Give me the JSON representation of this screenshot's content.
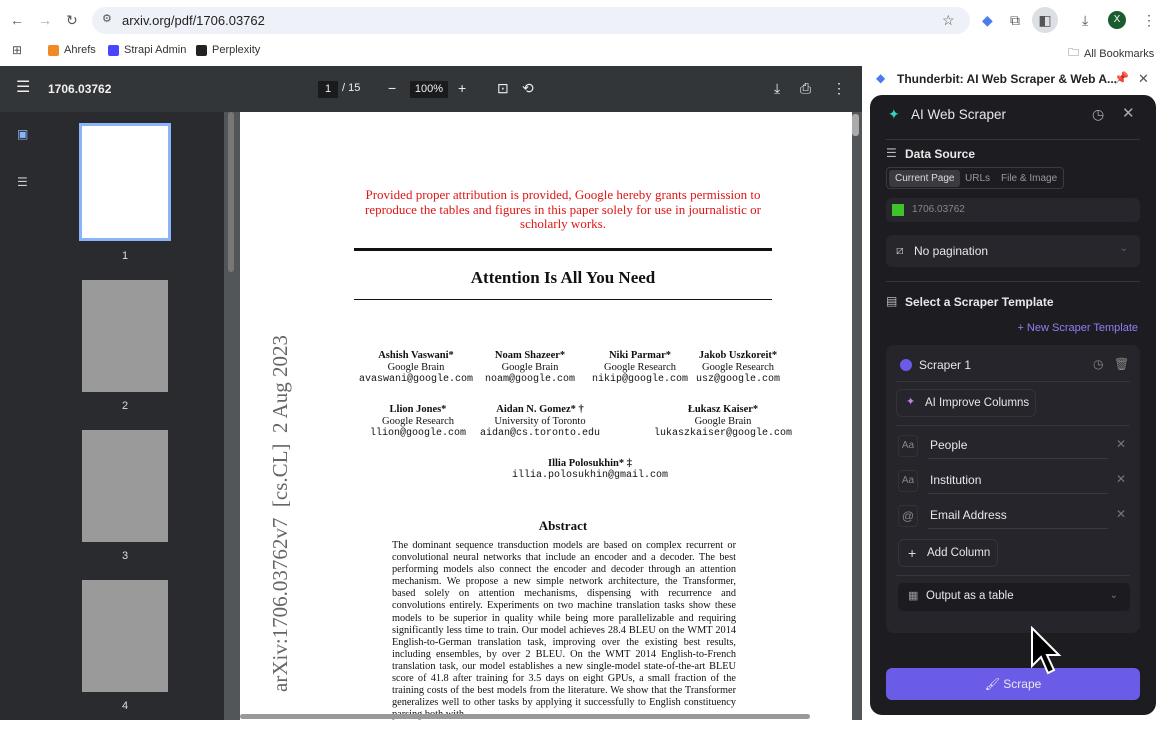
{
  "browser": {
    "url": "arxiv.org/pdf/1706.03762",
    "bookmarks": [
      "Ahrefs",
      "Strapi Admin",
      "Perplexity"
    ],
    "all_bookmarks": "All Bookmarks",
    "profile_initial": "X"
  },
  "pdf_toolbar": {
    "title": "1706.03762",
    "page": "1",
    "total": "/ 15",
    "zoom": "100%"
  },
  "thumbnails": [
    "1",
    "2",
    "3",
    "4"
  ],
  "paper": {
    "notice": "Provided proper attribution is provided, Google hereby grants permission to reproduce the tables and figures in this paper solely for use in journalistic or scholarly works.",
    "title": "Attention Is All You Need",
    "arxiv_id": "arXiv:1706.03762v7  [cs.CL]  2 Aug 2023",
    "authors": [
      {
        "name": "Ashish Vaswani*",
        "inst": "Google Brain",
        "email": "avaswani@google.com"
      },
      {
        "name": "Noam Shazeer*",
        "inst": "Google Brain",
        "email": "noam@google.com"
      },
      {
        "name": "Niki Parmar*",
        "inst": "Google Research",
        "email": "nikip@google.com"
      },
      {
        "name": "Jakob Uszkoreit*",
        "inst": "Google Research",
        "email": "usz@google.com"
      },
      {
        "name": "Llion Jones*",
        "inst": "Google Research",
        "email": "llion@google.com"
      },
      {
        "name": "Aidan N. Gomez* †",
        "inst": "University of Toronto",
        "email": "aidan@cs.toronto.edu"
      },
      {
        "name": "Łukasz Kaiser*",
        "inst": "Google Brain",
        "email": "lukaszkaiser@google.com"
      },
      {
        "name": "Illia Polosukhin* ‡",
        "inst": "",
        "email": "illia.polosukhin@gmail.com"
      }
    ],
    "abstract_heading": "Abstract",
    "abstract": "The dominant sequence transduction models are based on complex recurrent or convolutional neural networks that include an encoder and a decoder. The best performing models also connect the encoder and decoder through an attention mechanism. We propose a new simple network architecture, the Transformer, based solely on attention mechanisms, dispensing with recurrence and convolutions entirely. Experiments on two machine translation tasks show these models to be superior in quality while being more parallelizable and requiring significantly less time to train. Our model achieves 28.4 BLEU on the WMT 2014 English-to-German translation task, improving over the existing best results, including ensembles, by over 2 BLEU. On the WMT 2014 English-to-French translation task, our model establishes a new single-model state-of-the-art BLEU score of 41.8 after training for 3.5 days on eight GPUs, a small fraction of the training costs of the best models from the literature. We show that the Transformer generalizes well to other tasks by applying it successfully to English constituency parsing both with"
  },
  "extension": {
    "tab_title": "Thunderbit: AI Web Scraper & Web A...",
    "title": "AI Web Scraper",
    "data_source": "Data Source",
    "source_tabs": [
      "Current Page",
      "URLs",
      "File & Image"
    ],
    "current_source": "1706.03762",
    "pagination": "No pagination",
    "template_heading": "Select a Scraper Template",
    "new_template": "New Scraper Template",
    "scraper_name": "Scraper 1",
    "improve": "AI Improve Columns",
    "columns": [
      {
        "type": "Aa",
        "name": "People"
      },
      {
        "type": "Aa",
        "name": "Institution"
      },
      {
        "type": "@",
        "name": "Email Address"
      }
    ],
    "add_column": "Add Column",
    "output": "Output as a table",
    "scrape": "Scrape",
    "accent": "#6b5ce7"
  }
}
